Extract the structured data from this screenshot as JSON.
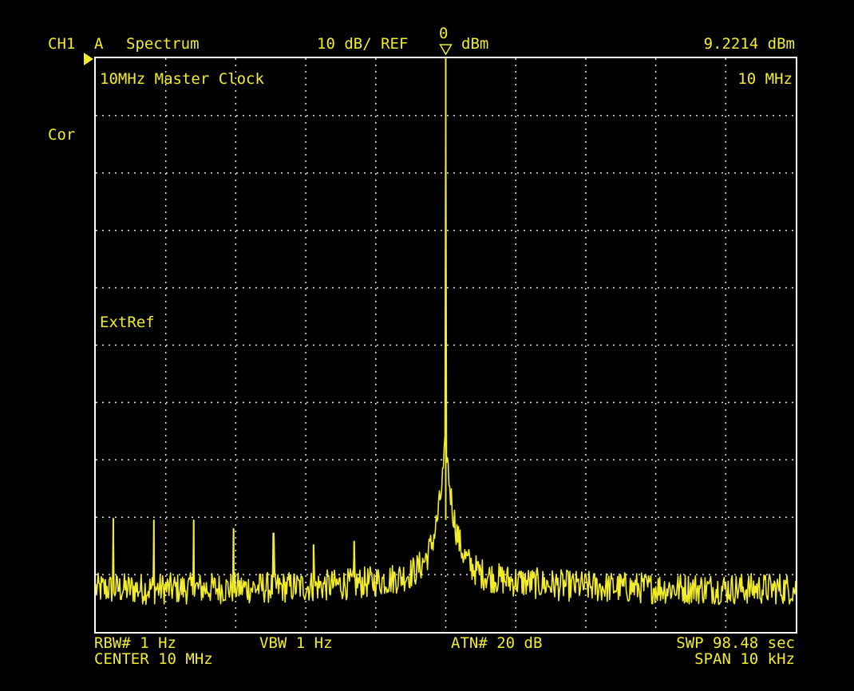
{
  "colors": {
    "background": "#000000",
    "trace": "#f2ec2a",
    "grid": "#e6e6e6",
    "frame": "#ffffff"
  },
  "header": {
    "channel": "CH1",
    "trace_label": "A",
    "mode": "Spectrum",
    "scale": "10 dB/ REF",
    "ref_value": "0",
    "ref_unit": "dBm",
    "marker_value": "9.2214 dBm"
  },
  "side": {
    "correction": "Cor"
  },
  "annotations": {
    "title": "10MHz Master Clock",
    "marker_freq": "10 MHz",
    "ext_ref": "ExtRef"
  },
  "footer": {
    "rbw": "RBW# 1 Hz",
    "vbw": "VBW 1 Hz",
    "atn": "ATN# 20 dB",
    "swp": "SWP  98.48 sec",
    "center": "CENTER  10 MHz",
    "span": "SPAN  10 kHz"
  },
  "icons": {
    "ref_marker": "ref-level-arrow-icon",
    "peak_marker": "marker-triangle-icon"
  },
  "chart_data": {
    "type": "line",
    "title": "10MHz Master Clock",
    "ylabel": "dBm",
    "xlabel": "",
    "x_range_hz": [
      9995000,
      10005000
    ],
    "ylim": [
      -100,
      0
    ],
    "y_div_db": 10,
    "x_divisions": 10,
    "y_divisions": 10,
    "grid": true,
    "noise_floor_dbm": -92.5,
    "carrier": {
      "x_hz": 10000000,
      "level_dbm": 0
    },
    "spurs": [
      {
        "x_hz": 9995250,
        "level_dbm": -80.2
      },
      {
        "x_hz": 9995830,
        "level_dbm": -80.5
      },
      {
        "x_hz": 9996400,
        "level_dbm": -80.5
      },
      {
        "x_hz": 9996970,
        "level_dbm": -82
      },
      {
        "x_hz": 9997540,
        "level_dbm": -82.8
      },
      {
        "x_hz": 9998110,
        "level_dbm": -84.8
      },
      {
        "x_hz": 9998690,
        "level_dbm": -84.2
      }
    ]
  }
}
